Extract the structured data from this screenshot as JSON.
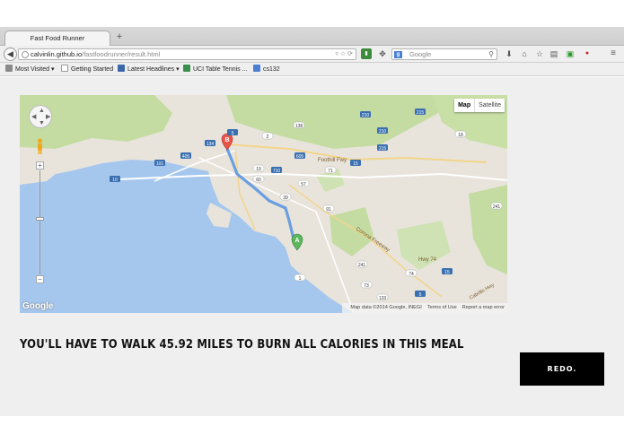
{
  "browser": {
    "tab_title": "Fast Food Runner",
    "new_tab_symbol": "+",
    "url_domain": "calvinlin.github.io",
    "url_path": "/fastfoodrunner/result.html",
    "search_engine_badge": "g",
    "search_placeholder": "Google",
    "bookmarks": [
      {
        "label": "Most Visited ▾",
        "icon": "gear-icon",
        "color": "#7a7a7a"
      },
      {
        "label": "Getting Started",
        "icon": "page-icon",
        "color": "#ffffff"
      },
      {
        "label": "Latest Headlines ▾",
        "icon": "rss-icon",
        "color": "#3b66a8"
      },
      {
        "label": "UCI Table Tennis ...",
        "icon": "page-icon",
        "color": "#3a8f4c"
      },
      {
        "label": "cs132",
        "icon": "google-icon",
        "color": "#4a7fd4"
      }
    ]
  },
  "map": {
    "type_buttons": [
      "Map",
      "Satellite"
    ],
    "active_type": "Map",
    "logo": "Google",
    "attribution": "Map data ©2014 Google, INEGI",
    "terms": "Terms of Use",
    "report": "Report a map error",
    "marker_start": "A",
    "marker_end": "B",
    "labels": {
      "foothill_fwy": "Foothill Fwy",
      "corona_fwy": "Corona Freeway",
      "hwy74": "Hwy 74",
      "cabrillo": "Cabrillo Hwy"
    },
    "highway_shields": [
      "210",
      "405",
      "5",
      "134",
      "2",
      "19",
      "710",
      "60",
      "57",
      "91",
      "605",
      "15",
      "215",
      "101",
      "1",
      "10",
      "71",
      "215",
      "210",
      "39",
      "138",
      "18",
      "241",
      "74",
      "5",
      "15",
      "133",
      "73",
      "241"
    ],
    "colors": {
      "water": "#a5c7ee",
      "land": "#e8e4dc",
      "parks": "#c4dca2",
      "route": "#6b9ee0"
    }
  },
  "result_text": "YOU'LL HAVE TO WALK 45.92 MILES TO BURN ALL CALORIES IN THIS MEAL",
  "redo_label": "REDO."
}
